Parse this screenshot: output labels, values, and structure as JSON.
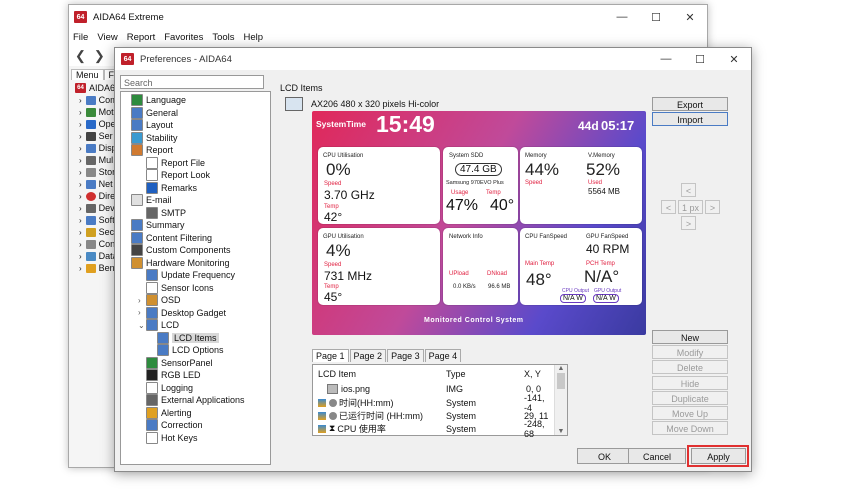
{
  "bg_window": {
    "title": "AIDA64 Extreme",
    "menu": [
      "File",
      "View",
      "Report",
      "Favorites",
      "Tools",
      "Help"
    ],
    "tabs": [
      "Menu",
      "Fa"
    ],
    "tree": [
      "AIDA64",
      "Com",
      "Mot",
      "Ope",
      "Ser",
      "Disp",
      "Mul",
      "Stor",
      "Net",
      "Dire",
      "Dev",
      "Soft",
      "Sec",
      "Con",
      "Data",
      "Ben"
    ]
  },
  "dialog": {
    "title": "Preferences - AIDA64",
    "search_placeholder": "Search",
    "tree": [
      {
        "label": "Language",
        "indent": 0,
        "arrow": "",
        "icon": "#2e8b3e"
      },
      {
        "label": "General",
        "indent": 0,
        "arrow": "",
        "icon": "#4a7bc4"
      },
      {
        "label": "Layout",
        "indent": 0,
        "arrow": "",
        "icon": "#4a7bc4"
      },
      {
        "label": "Stability",
        "indent": 0,
        "arrow": "",
        "icon": "#3a9ad0"
      },
      {
        "label": "Report",
        "indent": 0,
        "arrow": "",
        "icon": "#d07a30"
      },
      {
        "label": "Report File",
        "indent": 1,
        "arrow": "",
        "icon": "#ffffff"
      },
      {
        "label": "Report Look",
        "indent": 1,
        "arrow": "",
        "icon": "#ffffff"
      },
      {
        "label": "Remarks",
        "indent": 1,
        "arrow": "",
        "icon": "#2060c0"
      },
      {
        "label": "E-mail",
        "indent": 0,
        "arrow": "",
        "icon": "#e0e0e0"
      },
      {
        "label": "SMTP",
        "indent": 1,
        "arrow": "",
        "icon": "#666666"
      },
      {
        "label": "Summary",
        "indent": 0,
        "arrow": "",
        "icon": "#4a7bc4"
      },
      {
        "label": "Content Filtering",
        "indent": 0,
        "arrow": "",
        "icon": "#4a7bc4"
      },
      {
        "label": "Custom Components",
        "indent": 0,
        "arrow": "",
        "icon": "#444444"
      },
      {
        "label": "Hardware Monitoring",
        "indent": 0,
        "arrow": "",
        "icon": "#d09030"
      },
      {
        "label": "Update Frequency",
        "indent": 1,
        "arrow": "",
        "icon": "#4a7bc4"
      },
      {
        "label": "Sensor Icons",
        "indent": 1,
        "arrow": "",
        "icon": "#ffffff"
      },
      {
        "label": "OSD",
        "indent": 1,
        "arrow": ">",
        "icon": "#d09030"
      },
      {
        "label": "Desktop Gadget",
        "indent": 1,
        "arrow": ">",
        "icon": "#4a7bc4"
      },
      {
        "label": "LCD",
        "indent": 1,
        "arrow": "v",
        "icon": "#4a7bc4"
      },
      {
        "label": "LCD Items",
        "indent": 2,
        "arrow": "",
        "icon": "#4a7bc4",
        "selected": true
      },
      {
        "label": "LCD Options",
        "indent": 2,
        "arrow": "",
        "icon": "#4a7bc4"
      },
      {
        "label": "SensorPanel",
        "indent": 1,
        "arrow": "",
        "icon": "#2e8b3e"
      },
      {
        "label": "RGB LED",
        "indent": 1,
        "arrow": "",
        "icon": "#222222"
      },
      {
        "label": "Logging",
        "indent": 1,
        "arrow": "",
        "icon": "#ffffff"
      },
      {
        "label": "External Applications",
        "indent": 1,
        "arrow": "",
        "icon": "#666666"
      },
      {
        "label": "Alerting",
        "indent": 1,
        "arrow": "",
        "icon": "#e0a020"
      },
      {
        "label": "Correction",
        "indent": 1,
        "arrow": "",
        "icon": "#4a7bc4"
      },
      {
        "label": "Hot Keys",
        "indent": 1,
        "arrow": "",
        "icon": "#ffffff"
      }
    ],
    "group_label": "LCD Items",
    "device": "AX206 480 x 320 pixels Hi-color",
    "buttons_top": {
      "export": "Export",
      "import": "Import"
    },
    "nudge": {
      "up": "<",
      "left": "<",
      "step": "1 px",
      "right": ">",
      "down": ">"
    },
    "buttons_side": [
      {
        "label": "New",
        "enabled": true
      },
      {
        "label": "Modify",
        "enabled": false
      },
      {
        "label": "Delete",
        "enabled": false
      },
      {
        "label": "Hide",
        "enabled": false
      },
      {
        "label": "Duplicate",
        "enabled": false
      },
      {
        "label": "Move Up",
        "enabled": false
      },
      {
        "label": "Move Down",
        "enabled": false
      }
    ],
    "page_tabs": [
      "Page 1",
      "Page 2",
      "Page 3",
      "Page 4"
    ],
    "list_headers": [
      "LCD Item",
      "Type",
      "X, Y"
    ],
    "list_rows": [
      {
        "item": "ios.png",
        "type": "IMG",
        "xy": "0, 0"
      },
      {
        "item": "时间(HH:mm)",
        "type": "System",
        "xy": "-141, -4"
      },
      {
        "item": "已运行时间 (HH:mm)",
        "type": "System",
        "xy": "29, 11"
      },
      {
        "item": "CPU 使用率",
        "type": "System",
        "xy": "-248, 68"
      }
    ],
    "footer": {
      "ok": "OK",
      "cancel": "Cancel",
      "apply": "Apply"
    },
    "highlight_color": "#e03030"
  },
  "lcd": {
    "system_time_label": "SystemTime",
    "time": "15:49",
    "uptime_prefix": "44d",
    "uptime_time": "05:17",
    "cpu": {
      "title": "CPU Utilisation",
      "util": "0%",
      "speed_label": "Speed",
      "speed": "3.70 GHz",
      "temp_label": "Temp",
      "temp": "42°"
    },
    "ssd": {
      "title": "System SDD",
      "capacity": "47.4 GB",
      "model": "Samsung 970EVO Plus",
      "usage_label": "Usage",
      "temp_label": "Temp",
      "usage": "47%",
      "temp": "40°"
    },
    "memory": {
      "title": "Memory",
      "percent": "44%",
      "speed_label": "Speed",
      "vtitle": "V.Memory",
      "vpercent": "52%",
      "used_label": "Used",
      "used": "5564 MB"
    },
    "gpu": {
      "title": "GPU Utilisation",
      "util": "4%",
      "speed_label": "Speed",
      "speed": "731 MHz",
      "temp_label": "Temp",
      "temp": "45°"
    },
    "network": {
      "title": "Network Info",
      "up_label": "UPload",
      "down_label": "DNload",
      "up": "0.0 KB/s",
      "down": "96.6 MB"
    },
    "fan": {
      "cpu_title": "CPU FanSpeed",
      "gpu_title": "GPU FanSpeed",
      "gpu_rpm": "40 RPM",
      "main_temp_label": "Main Temp",
      "pch_temp_label": "PCH Temp",
      "main_temp": "48°",
      "pch_temp": "N/A°",
      "cpu_output_label": "CPU Output",
      "gpu_output_label": "GPU Output",
      "cpu_output": "N/A W",
      "gpu_output": "N/A W"
    },
    "footer": "Monitored Control System"
  }
}
